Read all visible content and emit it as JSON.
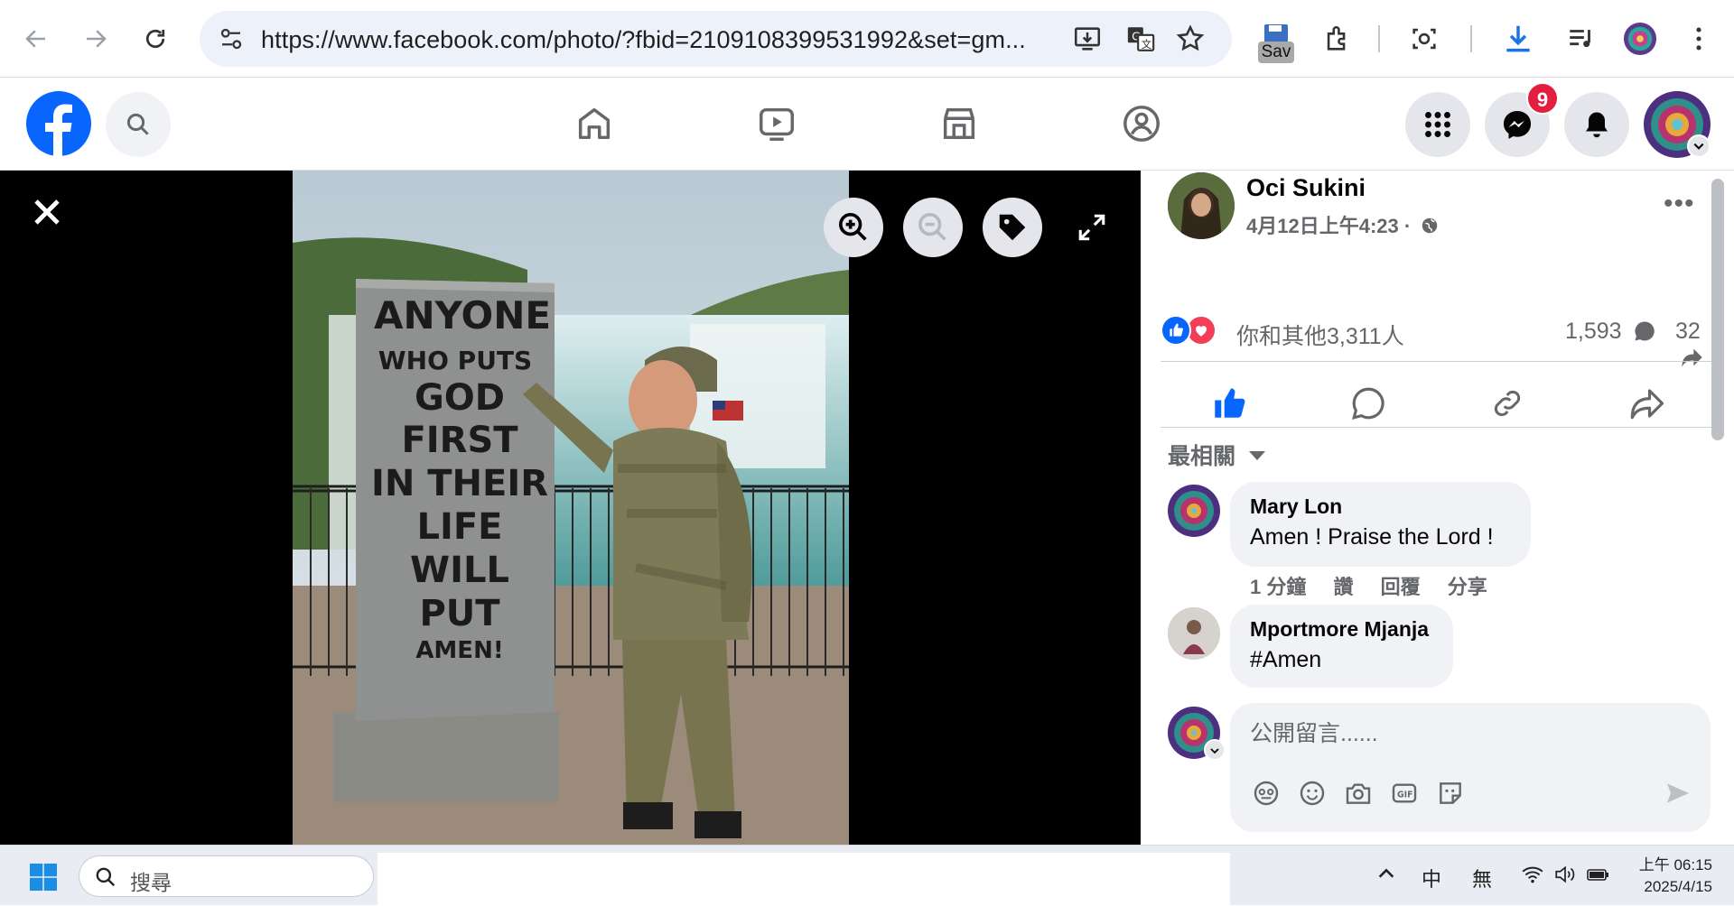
{
  "browser": {
    "url": "https://www.facebook.com/photo/?fbid=2109108399531992&set=gm...",
    "sav_label": "Sav"
  },
  "header": {
    "notification_count": "9"
  },
  "post": {
    "author": "Oci Sukini",
    "time": "4月12日上午4:23 ·",
    "reactions_text": "你和其他3,311人",
    "comment_count": "1,593",
    "share_count": "32",
    "sort_label": "最相關",
    "photo_sign_text": [
      "ANYONE",
      "WHO PUTS",
      "GOD",
      "FIRST",
      "IN THEIR",
      "LIFE",
      "WILL",
      "PUT",
      "AMEN!"
    ]
  },
  "comments": [
    {
      "name": "Mary Lon",
      "text": "Amen ! Praise the Lord !",
      "time": "1 分鐘",
      "like": "讚",
      "reply": "回覆",
      "share": "分享"
    },
    {
      "name": "Mportmore Mjanja",
      "text": "#Amen"
    }
  ],
  "composer": {
    "placeholder": "公開留言......"
  },
  "taskbar": {
    "search_placeholder": "搜尋",
    "ime_1": "中",
    "ime_2": "無",
    "time": "上午 06:15",
    "date": "2025/4/15"
  },
  "colors": {
    "facebook_blue": "#0866ff",
    "badge_red": "#e41e3f",
    "like_blue": "#0866ff",
    "love_red": "#f33e58"
  }
}
